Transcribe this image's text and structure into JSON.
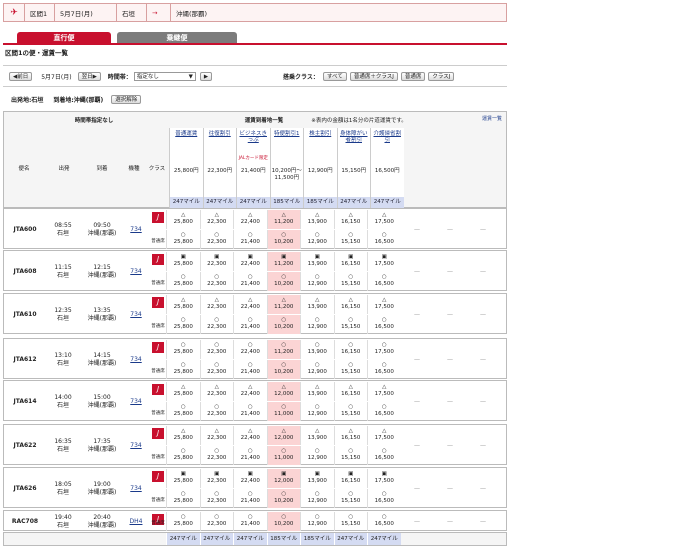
{
  "route": {
    "section_label": "区間1",
    "date": "5月7日(月)",
    "from": "石垣",
    "arrow": "→",
    "to": "沖縄(那覇)"
  },
  "tabs": {
    "direct": "直行便",
    "connect": "乗継便"
  },
  "section_title": "区間1の便・運賃一覧",
  "controls": {
    "prev": "◀前日",
    "date": "5月7日(月)",
    "next": "翌日▶",
    "time_label": "時間帯：",
    "time_value": "指定なし",
    "class_label": "搭乗クラス：",
    "classes": [
      "すべて",
      "普通席＋クラスJ",
      "普通席",
      "クラスJ"
    ]
  },
  "dep_label": "出発地:石垣",
  "arr_label": "到着地:沖縄(那覇)",
  "close_btn": "選択解除",
  "header": {
    "time_spec": "時間帯指定なし",
    "fare_title": "運賃到着地一覧",
    "note": "※表内の金額は1名分の片道運賃です。",
    "fare_link": "運賃一覧",
    "cols": [
      "便名",
      "出発",
      "到着",
      "機種",
      "クラス"
    ]
  },
  "fares": [
    {
      "name": "普通運賃",
      "price": "25,800円",
      "mile": "247マイル"
    },
    {
      "name": "往復割引",
      "price": "22,300円",
      "mile": "247マイル"
    },
    {
      "name": "ビジネスきっぷ",
      "price": "21,400円",
      "mile": "247マイル",
      "sub": "JALカード限定"
    },
    {
      "name": "特便割引1",
      "price": "10,200円〜11,500円",
      "mile": "185マイル"
    },
    {
      "name": "株主割引",
      "price": "12,900円",
      "mile": "185マイル"
    },
    {
      "name": "身体障がい者割引",
      "price": "15,150円",
      "mile": "247マイル"
    },
    {
      "name": "介護帰省割引",
      "price": "16,500円",
      "mile": "247マイル"
    }
  ],
  "flights": [
    {
      "no": "JTA600",
      "dep": "08:55",
      "dep_ap": "石垣",
      "arr": "09:50",
      "arr_ap": "沖縄(那覇)",
      "eq": "734",
      "cls": "普通席",
      "r1": [
        "△ 25,800",
        "△ 22,300",
        "△ 22,400",
        "△ 11,200",
        "△ 13,900",
        "△ 16,150",
        "△ 17,500"
      ],
      "r2": [
        "○ 25,800",
        "○ 22,300",
        "○ 21,400",
        "○ 10,200",
        "○ 12,900",
        "○ 15,150",
        "○ 16,500"
      ]
    },
    {
      "no": "JTA608",
      "dep": "11:15",
      "dep_ap": "石垣",
      "arr": "12:15",
      "arr_ap": "沖縄(那覇)",
      "eq": "734",
      "cls": "普通席",
      "r1": [
        "▣ 25,800",
        "▣ 22,300",
        "▣ 22,400",
        "▣ 11,200",
        "▣ 13,900",
        "▣ 16,150",
        "▣ 17,500"
      ],
      "r2": [
        "○ 25,800",
        "○ 22,300",
        "○ 21,400",
        "○ 10,200",
        "○ 12,900",
        "○ 15,150",
        "○ 16,500"
      ]
    },
    {
      "no": "JTA610",
      "dep": "12:35",
      "dep_ap": "石垣",
      "arr": "13:35",
      "arr_ap": "沖縄(那覇)",
      "eq": "734",
      "cls": "普通席",
      "r1": [
        "△ 25,800",
        "△ 22,300",
        "△ 22,400",
        "△ 11,200",
        "△ 13,900",
        "△ 16,150",
        "△ 17,500"
      ],
      "r2": [
        "○ 25,800",
        "○ 22,300",
        "○ 21,400",
        "○ 10,200",
        "○ 12,900",
        "○ 15,150",
        "○ 16,500"
      ]
    },
    {
      "no": "JTA612",
      "dep": "13:10",
      "dep_ap": "石垣",
      "arr": "14:15",
      "arr_ap": "沖縄(那覇)",
      "eq": "734",
      "cls": "普通席",
      "r1": [
        "○ 25,800",
        "○ 22,300",
        "○ 22,400",
        "○ 11,200",
        "○ 13,900",
        "○ 16,150",
        "○ 17,500"
      ],
      "r2": [
        "○ 25,800",
        "○ 22,300",
        "○ 21,400",
        "○ 10,200",
        "○ 12,900",
        "○ 15,150",
        "○ 16,500"
      ]
    },
    {
      "no": "JTA614",
      "dep": "14:00",
      "dep_ap": "石垣",
      "arr": "15:00",
      "arr_ap": "沖縄(那覇)",
      "eq": "734",
      "cls": "普通席",
      "r1": [
        "△ 25,800",
        "△ 22,300",
        "△ 22,400",
        "△ 12,000",
        "△ 13,900",
        "△ 16,150",
        "△ 17,500"
      ],
      "r2": [
        "○ 25,800",
        "○ 22,300",
        "○ 21,400",
        "○ 11,000",
        "○ 12,900",
        "○ 15,150",
        "○ 16,500"
      ]
    },
    {
      "no": "JTA622",
      "dep": "16:35",
      "dep_ap": "石垣",
      "arr": "17:35",
      "arr_ap": "沖縄(那覇)",
      "eq": "734",
      "cls": "普通席",
      "r1": [
        "△ 25,800",
        "△ 22,300",
        "△ 22,400",
        "△ 12,000",
        "△ 13,900",
        "△ 16,150",
        "△ 17,500"
      ],
      "r2": [
        "○ 25,800",
        "○ 22,300",
        "○ 21,400",
        "○ 11,000",
        "○ 12,900",
        "○ 15,150",
        "○ 16,500"
      ]
    },
    {
      "no": "JTA626",
      "dep": "18:05",
      "dep_ap": "石垣",
      "arr": "19:00",
      "arr_ap": "沖縄(那覇)",
      "eq": "734",
      "cls": "普通席",
      "r1": [
        "▣ 25,800",
        "▣ 22,300",
        "▣ 22,400",
        "▣ 12,000",
        "▣ 13,900",
        "▣ 16,150",
        "▣ 17,500"
      ],
      "r2": [
        "○ 25,800",
        "○ 22,300",
        "○ 21,400",
        "○ 10,200",
        "○ 12,900",
        "○ 15,150",
        "○ 16,500"
      ]
    },
    {
      "no": "RAC708",
      "dep": "19:40",
      "dep_ap": "石垣",
      "arr": "20:40",
      "arr_ap": "沖縄(那覇)",
      "eq": "DH4",
      "cls": "普通席",
      "r1": [
        "○ 25,800",
        "○ 22,300",
        "○ 21,400",
        "○ 10,200",
        "○ 12,900",
        "○ 15,150",
        "○ 16,500"
      ],
      "r2": null
    }
  ],
  "bottom_miles": [
    "247マイル",
    "247マイル",
    "247マイル",
    "185マイル",
    "185マイル",
    "247マイル",
    "247マイル"
  ],
  "colors": {
    "accent": "#c8102e",
    "mile_bg": "#d4dbf2",
    "pink": "#fbd4d4"
  }
}
